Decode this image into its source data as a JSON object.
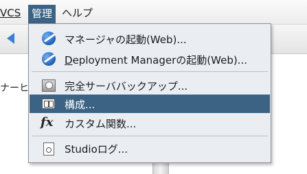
{
  "menubar": {
    "item_vcs": "VCS",
    "item_manage": "管理",
    "item_help": "ヘルプ"
  },
  "background": {
    "partial_text": "ナーヒ"
  },
  "menu": {
    "items": [
      {
        "label": "マネージャの起動(Web)...",
        "icon": "web-globe-icon"
      },
      {
        "label_mnemonic": "D",
        "label_rest": "eployment Managerの起動(Web)...",
        "icon": "web-globe-icon"
      },
      {
        "label": "完全サーババックアップ...",
        "icon": "backup-icon"
      },
      {
        "label": "構成...",
        "icon": "configuration-icon",
        "selected": true
      },
      {
        "label": "カスタム関数...",
        "icon": "fx-function-icon"
      },
      {
        "label": "Studioログ...",
        "icon": "log-document-icon"
      }
    ]
  },
  "colors": {
    "selection": "#3c6384",
    "menu_background": "#eaeef3",
    "toolbar_arrow": "#3b7fd4"
  }
}
